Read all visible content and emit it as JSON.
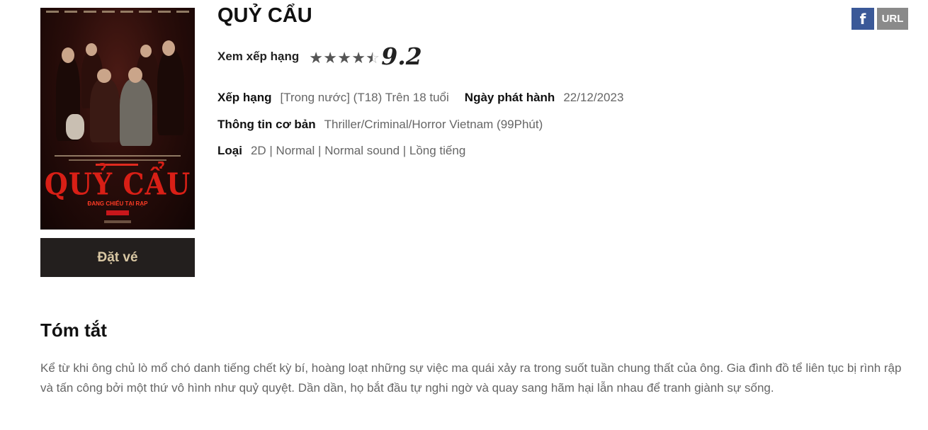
{
  "movie": {
    "title": "QUỶ CẨU",
    "poster_title": "QUỶ CẨU",
    "poster_subtitle": "ĐANG CHIẾU TẠI RẠP",
    "book_label": "Đặt vé"
  },
  "share": {
    "facebook_label": "f",
    "url_label": "URL"
  },
  "rating": {
    "label": "Xem xếp hạng",
    "stars_filled": 4.5,
    "stars_total": 5,
    "score": "9.2"
  },
  "info": {
    "age_label": "Xếp hạng",
    "age_value": "[Trong nước] (T18) Trên 18 tuổi",
    "release_label": "Ngày phát hành",
    "release_value": "22/12/2023",
    "basic_label": "Thông tin cơ bản",
    "basic_value": "Thriller/Criminal/Horror Vietnam (99Phút)",
    "type_label": "Loại",
    "type_value": "2D | Normal | Normal sound | Lồng tiếng"
  },
  "summary": {
    "title": "Tóm tắt",
    "text": "Kể từ khi ông chủ lò mổ chó danh tiếng chết kỳ bí, hoàng loạt những sự việc ma quái xảy ra trong suốt tuần chung thất của ông. Gia đình đồ tể liên tục bị rình rập và tấn công bởi một thứ vô hình như quỷ quyệt. Dần dần, họ bắt đầu tự nghi ngờ và quay sang hãm hại lẫn nhau để tranh giành sự sống."
  },
  "colors": {
    "facebook": "#3b5998",
    "book_button_bg": "#231f1e",
    "book_button_text": "#d8c7a3",
    "poster_title": "#d81f16"
  }
}
